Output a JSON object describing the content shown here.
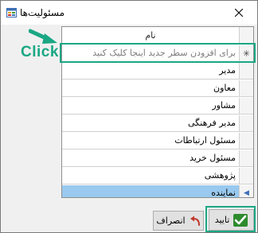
{
  "window": {
    "title": "مسئولیت‌ها"
  },
  "grid": {
    "column_header": "نام",
    "new_row_marker": "✳",
    "new_row_placeholder": "برای افزودن سطر جدید اینجا کلیک کنید",
    "rows": [
      {
        "name": "مدیر"
      },
      {
        "name": "معاون"
      },
      {
        "name": "مشاور"
      },
      {
        "name": "مدیر فرهنگی"
      },
      {
        "name": "مسئول ارتباطات"
      },
      {
        "name": "مسئول خرید"
      },
      {
        "name": "پژوهشی"
      },
      {
        "name": "نماینده"
      }
    ],
    "selected_row_marker": "◀"
  },
  "buttons": {
    "ok_label": "تایید",
    "cancel_label": "انصراف"
  },
  "annotation": {
    "label": "Click",
    "color": "#1aa784"
  },
  "icons": {
    "app": "app-window-icon",
    "close": "close-icon",
    "ok": "checkmark-icon",
    "cancel": "undo-arrow-icon"
  }
}
